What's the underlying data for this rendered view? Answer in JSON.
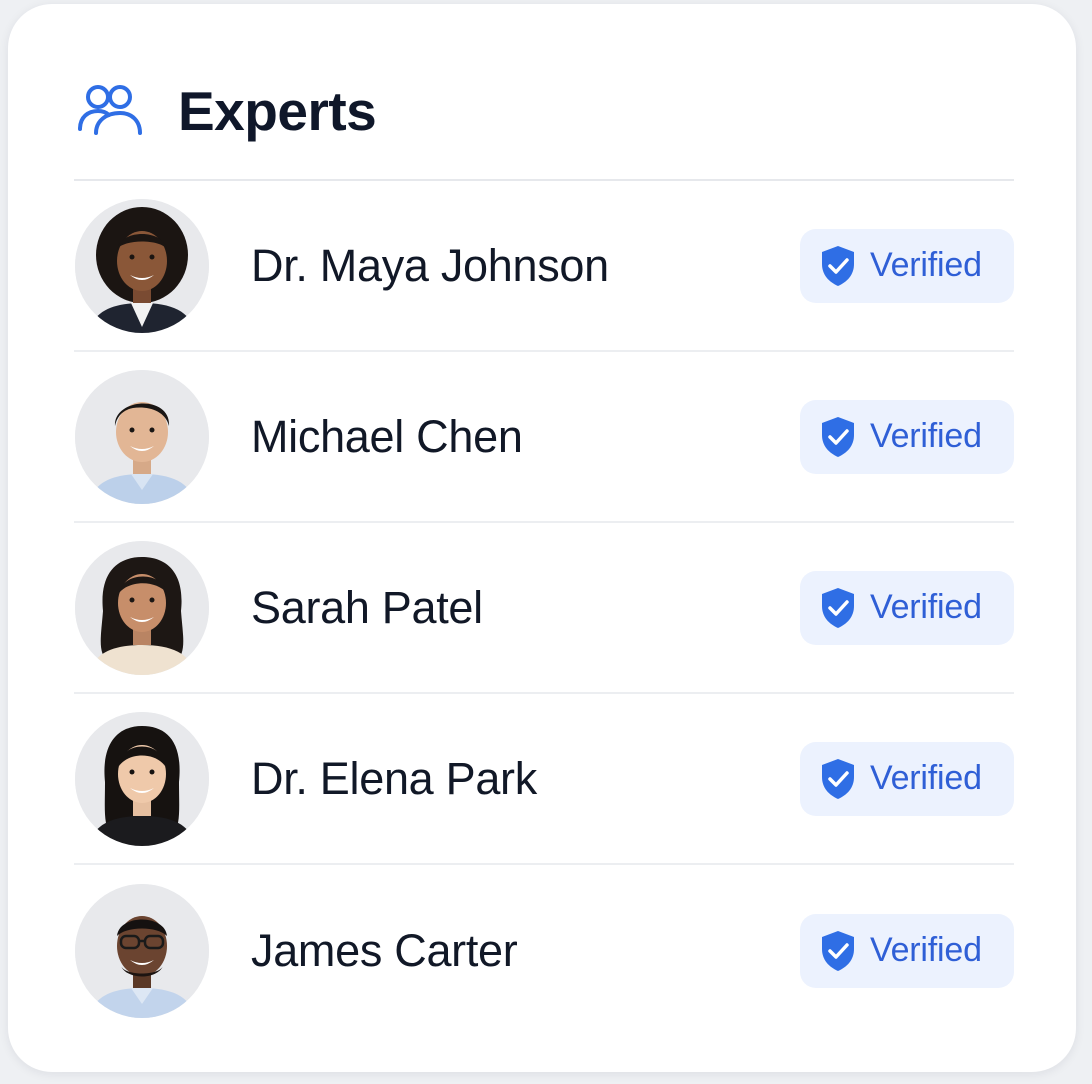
{
  "header": {
    "title": "Experts",
    "icon": "users-icon"
  },
  "colors": {
    "accent": "#2f6ee5",
    "badge_bg": "#ecf2fe",
    "title": "#0f172a"
  },
  "experts": [
    {
      "name": "Dr. Maya Johnson",
      "badge": "Verified",
      "avatar": "avatar-photo"
    },
    {
      "name": "Michael Chen",
      "badge": "Verified",
      "avatar": "avatar-photo"
    },
    {
      "name": "Sarah Patel",
      "badge": "Verified",
      "avatar": "avatar-photo"
    },
    {
      "name": "Dr. Elena Park",
      "badge": "Verified",
      "avatar": "avatar-photo"
    },
    {
      "name": "James Carter",
      "badge": "Verified",
      "avatar": "avatar-photo"
    }
  ]
}
